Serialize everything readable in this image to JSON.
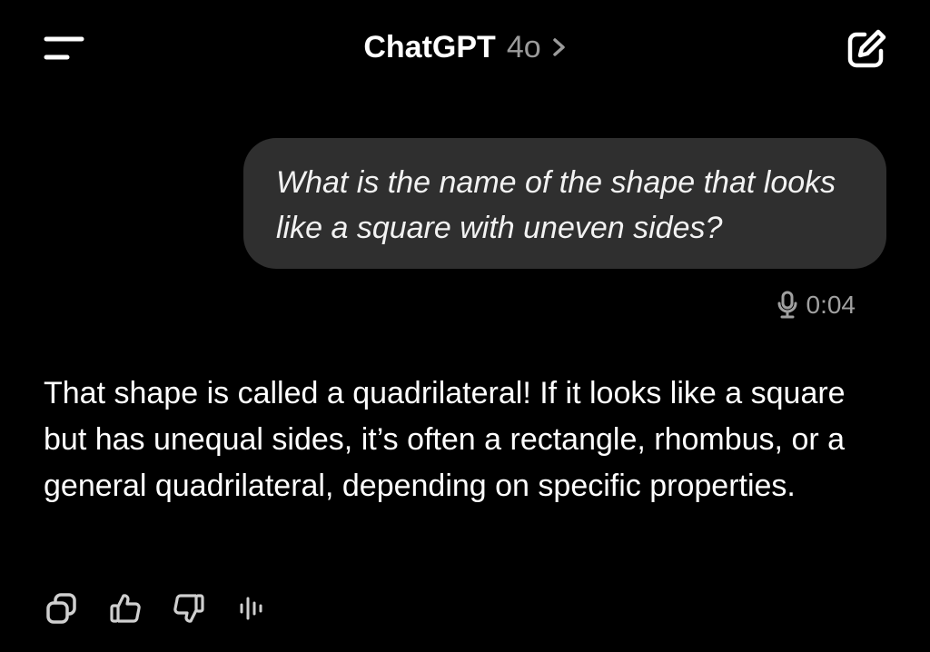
{
  "header": {
    "title_app": "ChatGPT",
    "title_model": "4o",
    "menu_icon": "menu-icon",
    "model_chevron_icon": "chevron-right-icon",
    "new_chat_icon": "compose-icon"
  },
  "conversation": {
    "user_message": {
      "text": "What is the name of the shape that looks like a square with uneven sides?",
      "voice_icon": "microphone-icon",
      "voice_duration": "0:04"
    },
    "assistant_message": {
      "text": "That shape is called a quadrilateral! If it looks like a square but has unequal sides, it’s often a rectangle, rhombus, or a general quadrilateral, depending on specific properties."
    },
    "actions": [
      {
        "icon": "copy-icon"
      },
      {
        "icon": "thumbs-up-icon"
      },
      {
        "icon": "thumbs-down-icon"
      },
      {
        "icon": "read-aloud-icon"
      }
    ]
  },
  "colors": {
    "background": "#000000",
    "bubble": "#2f2f2f",
    "muted_text": "#9b9b9b"
  }
}
